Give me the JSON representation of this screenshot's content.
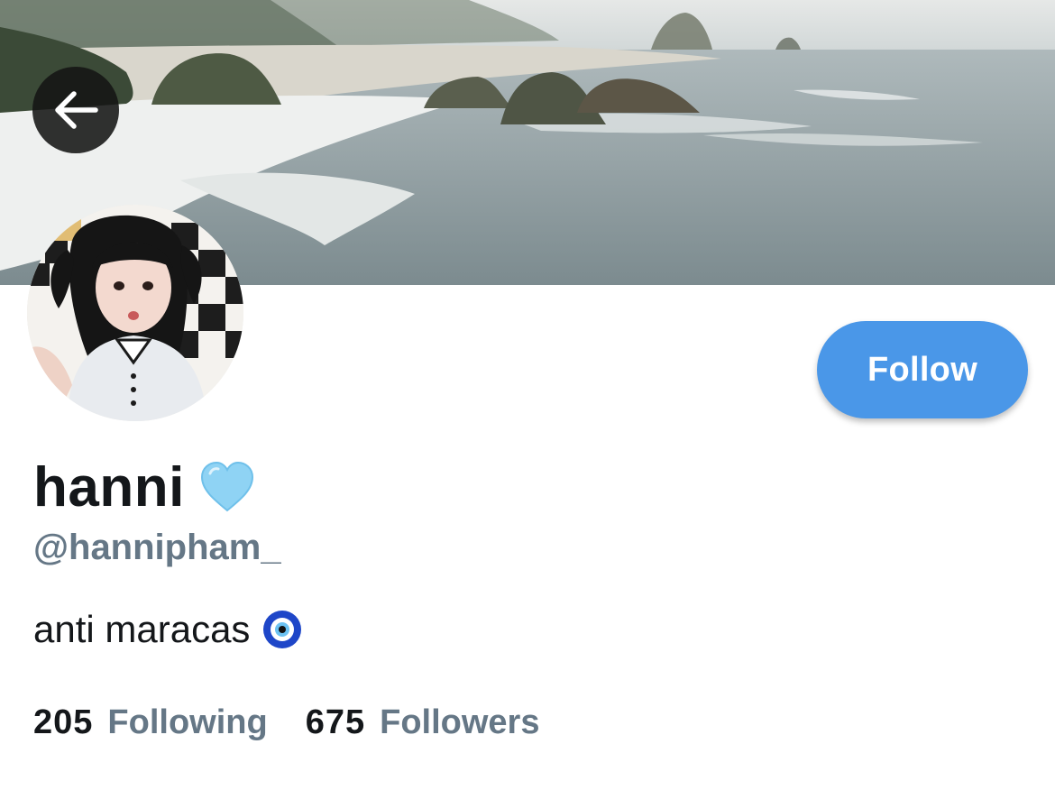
{
  "profile": {
    "display_name": "hanni",
    "handle": "@hannipham_",
    "bio": "anti maracas",
    "name_emoji_icon": "light-blue-heart-icon",
    "bio_emoji_icon": "nazar-amulet-icon"
  },
  "actions": {
    "follow_label": "Follow",
    "back_icon": "arrow-left-icon"
  },
  "stats": {
    "following_count": "205",
    "following_label": "Following",
    "followers_count": "675",
    "followers_label": "Followers"
  },
  "colors": {
    "accent": "#4a97e8",
    "text_primary": "#14171a",
    "text_secondary": "#657786",
    "heart": "#8fd3f4"
  }
}
